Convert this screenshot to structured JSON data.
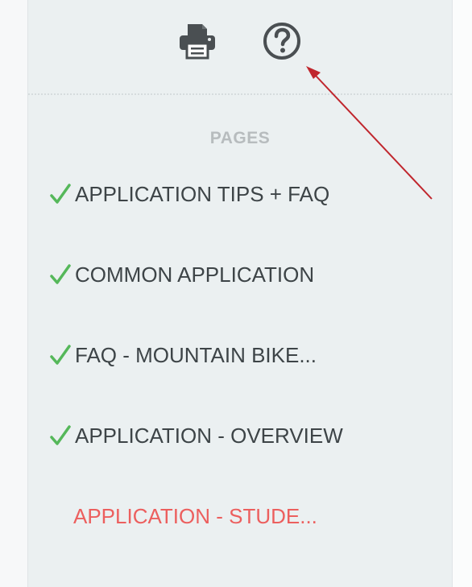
{
  "sidebar": {
    "toolbar": {
      "print_icon": "print-icon",
      "help_icon": "help-icon"
    },
    "section_title": "PAGES",
    "items": [
      {
        "label": "APPLICATION TIPS + FAQ",
        "completed": true
      },
      {
        "label": "COMMON APPLICATION",
        "completed": true
      },
      {
        "label": "FAQ - MOUNTAIN BIKE...",
        "completed": true
      },
      {
        "label": "APPLICATION - OVERVIEW",
        "completed": true
      },
      {
        "label": "APPLICATION - STUDE...",
        "completed": false,
        "active": true
      }
    ]
  },
  "colors": {
    "sidebar_bg": "#ebf0f1",
    "check": "#55b85a",
    "active_text": "#ec5f5e",
    "text": "#3d4447",
    "heading": "#b7bcbe",
    "annotation_arrow": "#c0262d"
  }
}
